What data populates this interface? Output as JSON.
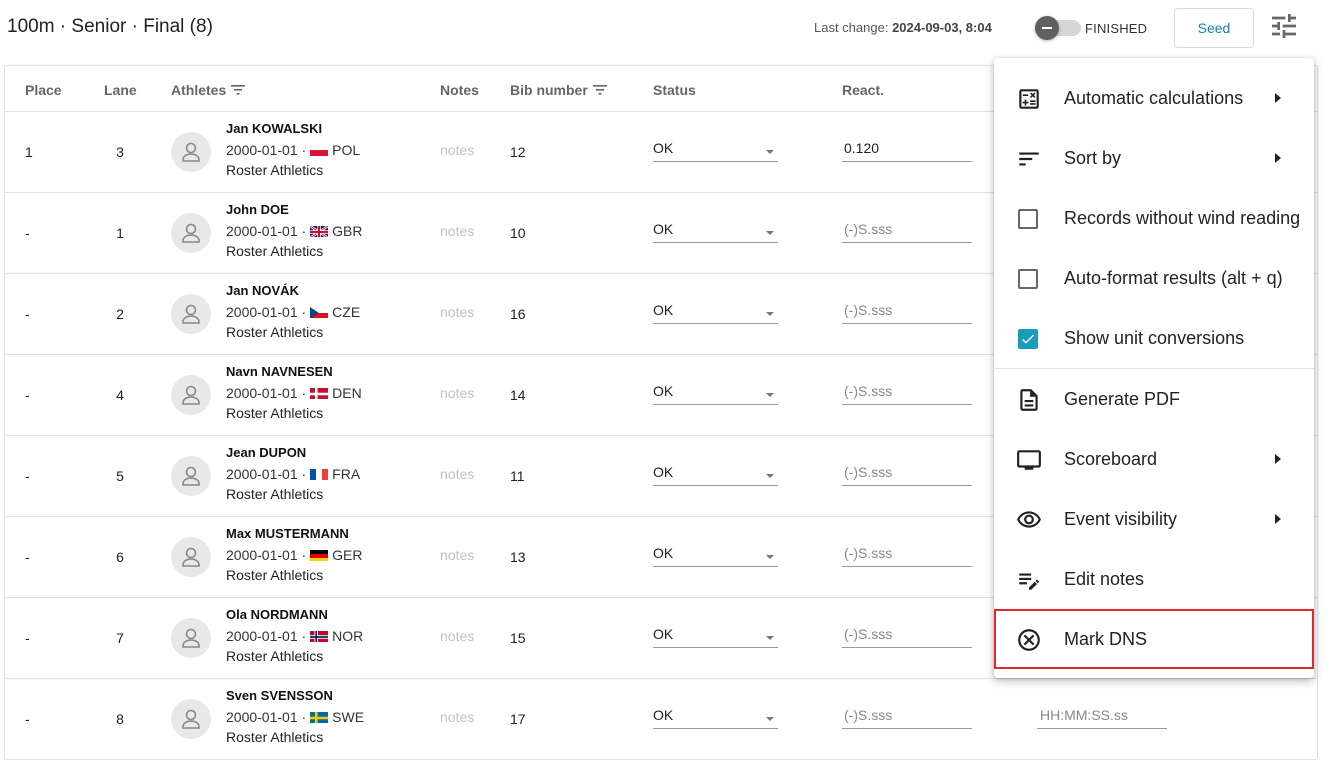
{
  "header": {
    "title": "100m · Senior · Final (8)",
    "last_change_label": "Last change:",
    "last_change_value": "2024-09-03, 8:04",
    "finished_label": "FINISHED",
    "seed_label": "Seed"
  },
  "table": {
    "columns": {
      "place": "Place",
      "lane": "Lane",
      "athletes": "Athletes",
      "notes": "Notes",
      "bib": "Bib number",
      "status": "Status",
      "react": "React."
    },
    "notes_placeholder": "notes",
    "react_placeholder": "(-)S.sss",
    "time_placeholder": "HH:MM:SS.ss",
    "rows": [
      {
        "place": "1",
        "lane": "3",
        "name": "Jan KOWALSKI",
        "dob": "2000-01-01 ·",
        "country": "POL",
        "club": "Roster Athletics",
        "bib": "12",
        "status": "OK",
        "react": "0.120"
      },
      {
        "place": "-",
        "lane": "1",
        "name": "John DOE",
        "dob": "2000-01-01 ·",
        "country": "GBR",
        "club": "Roster Athletics",
        "bib": "10",
        "status": "OK",
        "react": ""
      },
      {
        "place": "-",
        "lane": "2",
        "name": "Jan NOVÁK",
        "dob": "2000-01-01 ·",
        "country": "CZE",
        "club": "Roster Athletics",
        "bib": "16",
        "status": "OK",
        "react": ""
      },
      {
        "place": "-",
        "lane": "4",
        "name": "Navn NAVNESEN",
        "dob": "2000-01-01 ·",
        "country": "DEN",
        "club": "Roster Athletics",
        "bib": "14",
        "status": "OK",
        "react": ""
      },
      {
        "place": "-",
        "lane": "5",
        "name": "Jean DUPON",
        "dob": "2000-01-01 ·",
        "country": "FRA",
        "club": "Roster Athletics",
        "bib": "11",
        "status": "OK",
        "react": ""
      },
      {
        "place": "-",
        "lane": "6",
        "name": "Max MUSTERMANN",
        "dob": "2000-01-01 ·",
        "country": "GER",
        "club": "Roster Athletics",
        "bib": "13",
        "status": "OK",
        "react": ""
      },
      {
        "place": "-",
        "lane": "7",
        "name": "Ola NORDMANN",
        "dob": "2000-01-01 ·",
        "country": "NOR",
        "club": "Roster Athletics",
        "bib": "15",
        "status": "OK",
        "react": ""
      },
      {
        "place": "-",
        "lane": "8",
        "name": "Sven SVENSSON",
        "dob": "2000-01-01 ·",
        "country": "SWE",
        "club": "Roster Athletics",
        "bib": "17",
        "status": "OK",
        "react": ""
      }
    ]
  },
  "menu": {
    "items": [
      {
        "label": "Automatic calculations",
        "icon": "calculator-icon"
      },
      {
        "label": "Sort by",
        "icon": "sort-icon"
      },
      {
        "label": "Records without wind reading",
        "icon": "checkbox-icon",
        "checked": false
      },
      {
        "label": "Auto-format results (alt + q)",
        "icon": "checkbox-icon",
        "checked": false
      },
      {
        "label": "Show unit conversions",
        "icon": "checkbox-icon",
        "checked": true
      },
      {
        "label": "Generate PDF",
        "icon": "document-icon"
      },
      {
        "label": "Scoreboard",
        "icon": "monitor-icon"
      },
      {
        "label": "Event visibility",
        "icon": "eye-icon"
      },
      {
        "label": "Edit notes",
        "icon": "edit-notes-icon"
      },
      {
        "label": "Mark DNS",
        "icon": "cancel-circle-icon"
      }
    ]
  },
  "colors": {
    "accent": "#1a9dbd",
    "highlight": "#e0282e",
    "seed_text": "#1582a8"
  }
}
